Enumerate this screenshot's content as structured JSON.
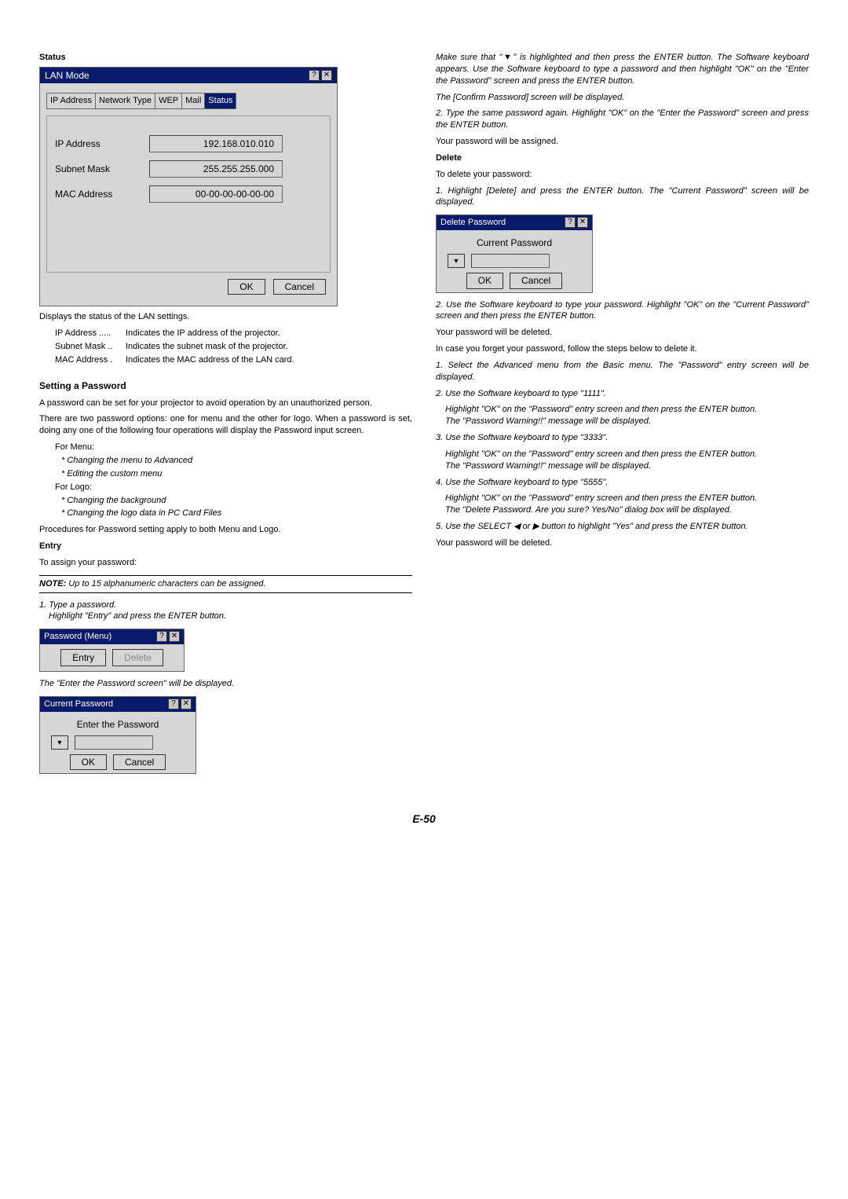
{
  "left": {
    "status_heading": "Status",
    "lan_dialog": {
      "title": "LAN Mode",
      "tabs": [
        "IP Address",
        "Network Type",
        "WEP",
        "Mail",
        "Status"
      ],
      "active_tab": "Status",
      "rows": [
        {
          "label": "IP Address",
          "value": "192.168.010.010"
        },
        {
          "label": "Subnet Mask",
          "value": "255.255.255.000"
        },
        {
          "label": "MAC Address",
          "value": "00-00-00-00-00-00"
        }
      ],
      "ok": "OK",
      "cancel": "Cancel"
    },
    "status_desc": "Displays the status of the LAN settings.",
    "defs": [
      {
        "k": "IP Address .....",
        "v": "Indicates the IP address of the projector."
      },
      {
        "k": "Subnet Mask ..",
        "v": "Indicates the subnet mask of the projector."
      },
      {
        "k": "MAC Address .",
        "v": "Indicates the MAC address of the LAN card."
      }
    ],
    "setting_heading": "Setting a Password",
    "setting_p1": "A password can be set for your projector to avoid operation by an unauthorized person.",
    "setting_p2": "There are two password options: one for menu and the other for logo. When a password is set, doing any one of the following four operations will display the Password input screen.",
    "for_menu": "For Menu:",
    "menu_items": [
      "Changing the menu to Advanced",
      "Editing the custom menu"
    ],
    "for_logo": "For Logo:",
    "logo_items": [
      "Changing the background",
      "Changing the logo data in PC Card Files"
    ],
    "procedures": "Procedures for Password setting apply to both Menu and Logo.",
    "entry_heading": "Entry",
    "entry_desc": "To assign your password:",
    "note": "NOTE: Up to 15 alphanumeric characters can be assigned.",
    "step1a": "1. Type a password.",
    "step1b": "Highlight \"Entry\" and press the ENTER button.",
    "pw_dialog": {
      "title": "Password (Menu)",
      "entry": "Entry",
      "delete": "Delete"
    },
    "enter_displayed": "The \"Enter the Password screen\" will be displayed.",
    "cp_dialog": {
      "title": "Current Password",
      "label": "Enter the Password",
      "ok": "OK",
      "cancel": "Cancel"
    }
  },
  "right": {
    "p1": "Make sure that \"▼\" is highlighted and then press the ENTER button. The Software keyboard appears. Use the Software keyboard to type a password and then highlight \"OK\" on the \"Enter the Password\" screen and press the ENTER button.",
    "p1b": "The [Confirm Password] screen will be displayed.",
    "p2": "2. Type the same password again. Highlight \"OK\" on the \"Enter the Password\" screen and press the ENTER button.",
    "assigned": "Your password will be assigned.",
    "delete_heading": "Delete",
    "delete_desc": "To delete your password:",
    "d1": "1. Highlight [Delete] and press the ENTER button. The \"Current Password\" screen will be displayed.",
    "dp_dialog": {
      "title": "Delete Password",
      "label": "Current Password",
      "ok": "OK",
      "cancel": "Cancel"
    },
    "d2": "2. Use the Software keyboard to type your password. Highlight \"OK\" on the \"Current Password\" screen and then press the ENTER button.",
    "deleted": "Your password will be deleted.",
    "forget": "In case you forget your password, follow the steps below to delete it.",
    "f1": "1. Select the Advanced menu from the Basic menu. The \"Password\" entry screen will be displayed.",
    "f2a": "2. Use the Software keyboard to type \"1111\".",
    "f2b": "Highlight \"OK\" on the \"Password\" entry screen and then press the ENTER button.",
    "f2c": "The \"Password Warning!!\" message will be displayed.",
    "f3a": "3. Use the Software keyboard to type \"3333\".",
    "f3b": "Highlight \"OK\" on the \"Password\" entry screen and then press the ENTER button.",
    "f3c": "The \"Password Warning!!\" message will be displayed.",
    "f4a": "4. Use the Software keyboard to type \"5555\".",
    "f4b": "Highlight \"OK\" on the \"Password\" entry screen and then press the ENTER button.",
    "f4c": "The \"Delete Password. Are you sure? Yes/No\" dialog box will be displayed.",
    "f5": "5. Use the SELECT ◀ or ▶ button to highlight \"Yes\" and press the ENTER button.",
    "deleted2": "Your password will be deleted."
  },
  "footer": "E-50"
}
